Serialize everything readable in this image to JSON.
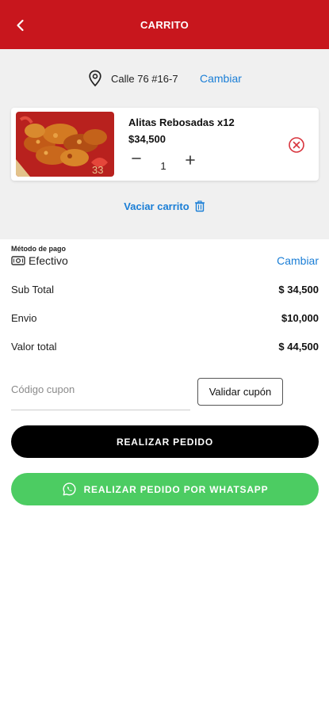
{
  "header": {
    "title": "CARRITO",
    "back_icon": "back-arrow-icon"
  },
  "address": {
    "text": "Calle 76 #16-7",
    "change_label": "Cambiar",
    "icon": "location-pin-icon"
  },
  "cart": {
    "items": [
      {
        "name": "Alitas Rebosadas x12",
        "price": "$34,500",
        "quantity": "1",
        "image": "fried-chicken-wings-photo"
      }
    ],
    "empty_label": "Vaciar carrito"
  },
  "payment": {
    "label": "Método de pago",
    "value": "Efectivo",
    "change_label": "Cambiar",
    "icon": "cash-icon"
  },
  "totals": [
    {
      "label": "Sub Total",
      "value": "$ 34,500"
    },
    {
      "label": "Envio",
      "value": "$10,000"
    },
    {
      "label": "Valor total",
      "value": "$ 44,500"
    }
  ],
  "coupon": {
    "placeholder": "Código cupon",
    "validate_label": "Validar cupón"
  },
  "actions": {
    "order_label": "REALIZAR PEDIDO",
    "whatsapp_label": "REALIZAR PEDIDO POR WHATSAPP"
  },
  "colors": {
    "brand_red": "#c8161d",
    "link_blue": "#1a7ed6",
    "whatsapp_green": "#4ccc62",
    "remove_red": "#d8343d"
  }
}
